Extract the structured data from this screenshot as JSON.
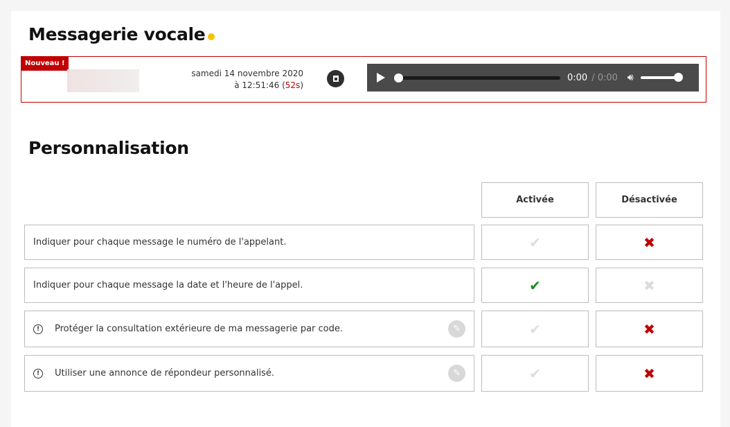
{
  "voicemail": {
    "title": "Messagerie vocale",
    "badge": "Nouveau !",
    "date": "samedi 14 novembre 2020",
    "time_prefix": "à 12:51:46 (",
    "duration": "52s",
    "time_suffix": ")",
    "player": {
      "current": "0:00",
      "total": "/ 0:00",
      "progress": 0,
      "volume": 1
    }
  },
  "personalisation": {
    "title": "Personnalisation",
    "col_on": "Activée",
    "col_off": "Désactivée",
    "rows": [
      {
        "label": "Indiquer pour chaque message le numéro de l'appelant.",
        "state": "off"
      },
      {
        "label": "Indiquer pour chaque message la date et l'heure de l'appel.",
        "state": "on"
      },
      {
        "label": "Protéger la consultation extérieure de ma messagerie par code.",
        "state": "off",
        "editable": true
      },
      {
        "label": "Utiliser une annonce de répondeur personnalisé.",
        "state": "off",
        "editable": true
      }
    ]
  },
  "colors": {
    "accent": "#c00000",
    "on": "#1e8a1e",
    "dot": "#f5c400"
  }
}
